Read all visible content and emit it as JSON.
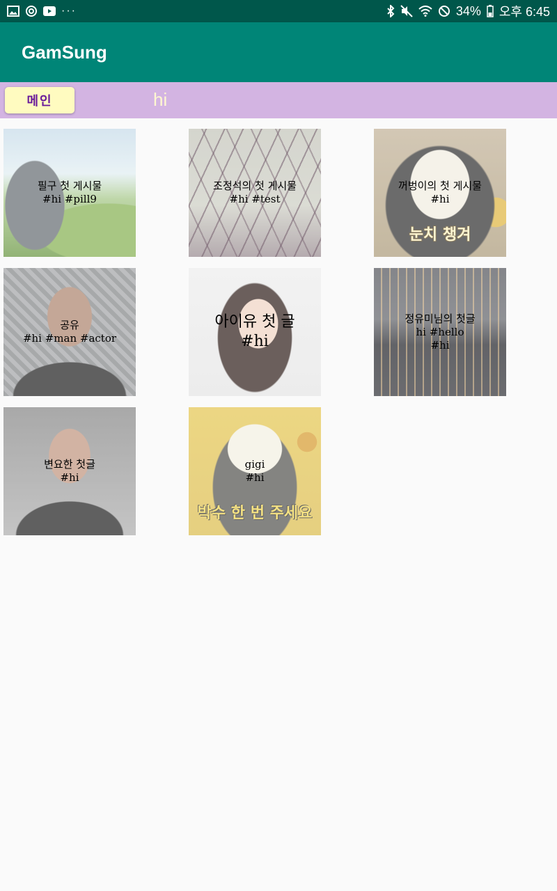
{
  "status_bar": {
    "battery": "34%",
    "time": "오후 6:45",
    "dots": "···",
    "icons": [
      "image-icon",
      "sync-icon",
      "youtube-icon",
      "bluetooth-icon",
      "mute-icon",
      "wifi-icon",
      "do-not-disturb-icon",
      "battery-icon"
    ]
  },
  "app_bar": {
    "title": "GamSung"
  },
  "filter_bar": {
    "main_button": "메인",
    "tag": "hi"
  },
  "posts": [
    {
      "title": "필구 첫 게시물",
      "tags": "#hi #pill9"
    },
    {
      "title": "조정석의 첫 게시물",
      "tags": "#hi #test"
    },
    {
      "title": "꺼벙이의 첫 게시물",
      "tags": "#hi",
      "image_text": "눈치 챙겨"
    },
    {
      "title": "공유",
      "tags": "#hi #man #actor"
    },
    {
      "title": "아이유 첫 글",
      "tags": "#hi"
    },
    {
      "title": "정유미님의 첫글",
      "tags": "hi #hello",
      "tags2": "#hi"
    },
    {
      "title": "변요한 첫글",
      "tags": "#hi"
    },
    {
      "title": "gigi",
      "tags": "#hi",
      "image_text": "박수 한 번 주세요"
    }
  ],
  "colors": {
    "status_bar": "#00574b",
    "app_bar": "#008577",
    "filter_bar": "#d3b4e2",
    "main_button": "#fffbc0"
  }
}
